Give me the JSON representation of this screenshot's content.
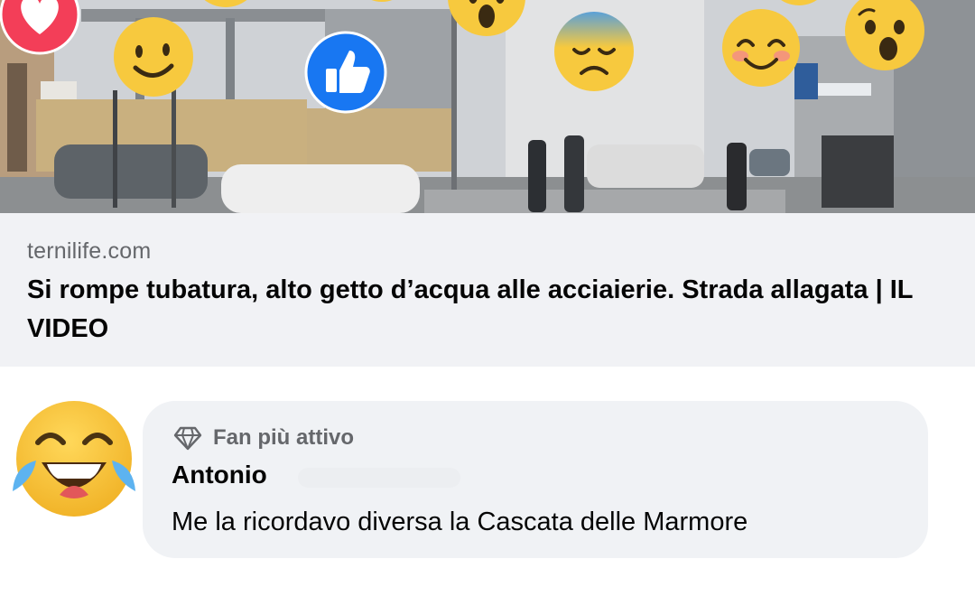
{
  "link_preview": {
    "domain": "ternilife.com",
    "headline": "Si rompe tubatura, alto getto d’acqua alle acciaierie. Strada allagata | IL VIDEO"
  },
  "photo_overlay": {
    "reactions": [
      "love-reaction",
      "smile-emoji",
      "like-reaction",
      "wow-emoji",
      "sad-emoji",
      "blush-emoji",
      "wow-emoji"
    ]
  },
  "comment": {
    "badge_label": "Fan più attivo",
    "author": "Antonio",
    "text": "Me la ricordavo diversa la Cascata delle Marmore",
    "avatar_icon": "tears-of-joy-emoji"
  },
  "colors": {
    "like_blue": "#1877f2",
    "love_red": "#f33e58",
    "emoji_yellow": "#f7c93e",
    "bubble_bg": "#f0f2f5",
    "meta_bg": "#f1f2f5",
    "secondary_text": "#65676b"
  }
}
